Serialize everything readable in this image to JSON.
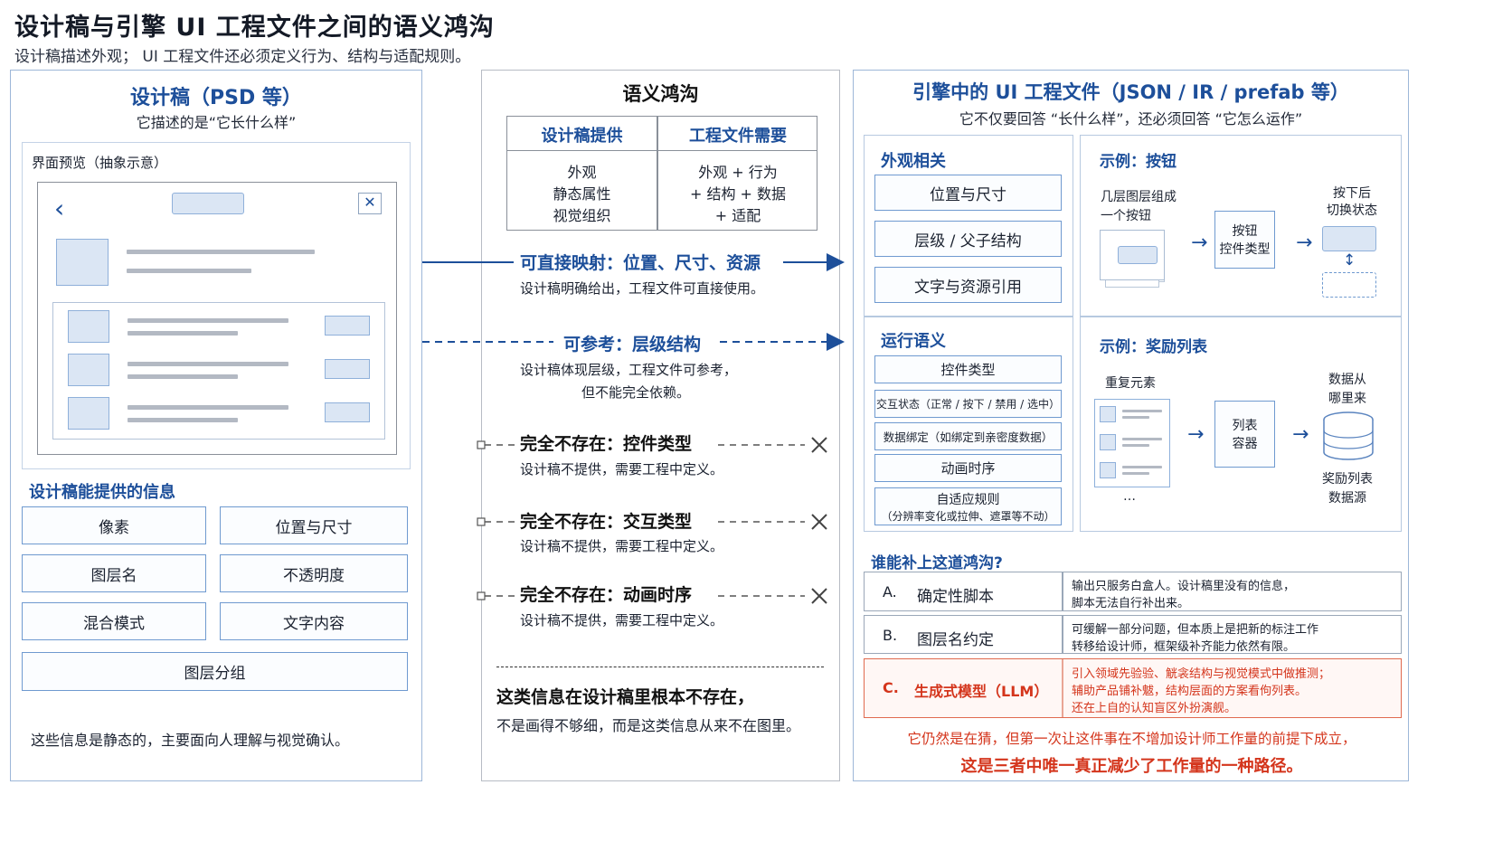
{
  "header": {
    "title": "设计稿与引擎 UI 工程文件之间的语义鸿沟",
    "subtitle": "设计稿描述外观； UI 工程文件还必须定义行为、结构与适配规则。"
  },
  "left": {
    "title": "设计稿（PSD 等）",
    "subtitle": "它描述的是“它长什么样”",
    "preview_label": "界面预览（抽象示意）",
    "info_header": "设计稿能提供的信息",
    "info_items": [
      "像素",
      "位置与尺寸",
      "图层名",
      "不透明度",
      "混合模式",
      "文字内容",
      "图层分组"
    ],
    "footer": "这些信息是静态的，主要面向人理解与视觉确认。"
  },
  "middle": {
    "title": "语义鸿沟",
    "table_headers": [
      "设计稿提供",
      "工程文件需要"
    ],
    "table_left": [
      "外观",
      "静态属性",
      "视觉组织"
    ],
    "table_right": [
      "外观 + 行为",
      "+ 结构 + 数据",
      "+ 适配"
    ],
    "rows": [
      {
        "title": "可直接映射：位置、尺寸、资源",
        "desc": "设计稿明确给出，工程文件可直接使用。"
      },
      {
        "title": "可参考：层级结构",
        "desc": "设计稿体现层级，工程文件可参考，",
        "desc2": "但不能完全依赖。"
      },
      {
        "title": "完全不存在：控件类型",
        "desc": "设计稿不提供，需要工程中定义。"
      },
      {
        "title": "完全不存在：交互类型",
        "desc": "设计稿不提供，需要工程中定义。"
      },
      {
        "title": "完全不存在：动画时序",
        "desc": "设计稿不提供，需要工程中定义。"
      }
    ],
    "conclusion_title": "这类信息在设计稿里根本不存在，",
    "conclusion_sub": "不是画得不够细，而是这类信息从来不在图里。"
  },
  "right": {
    "title": "引擎中的 UI 工程文件（JSON / IR / prefab 等）",
    "subtitle": "它不仅要回答 “长什么样”，还必须回答 “它怎么运作”",
    "appearance_header": "外观相关",
    "appearance_items": [
      "位置与尺寸",
      "层级 / 父子结构",
      "文字与资源引用"
    ],
    "runtime_header": "运行语义",
    "runtime_items": [
      "控件类型",
      "交互状态（正常 / 按下 / 禁用 / 选中）",
      "数据绑定（如绑定到亲密度数据）",
      "动画时序"
    ],
    "runtime_adapt_1": "自适应规则",
    "runtime_adapt_2": "（分辨率变化或拉伸、遮罩等不动）",
    "ex1_header": "示例：按钮",
    "ex1_left_1": "几层图层组成",
    "ex1_left_2": "一个按钮",
    "ex1_mid_1": "按钮",
    "ex1_mid_2": "控件类型",
    "ex1_right_1": "按下后",
    "ex1_right_2": "切换状态",
    "ex2_header": "示例：奖励列表",
    "ex2_left": "重复元素",
    "ex2_dots": "…",
    "ex2_mid_1": "列表",
    "ex2_mid_2": "容器",
    "ex2_right_top_1": "数据从",
    "ex2_right_top_2": "哪里来",
    "ex2_right_bot_1": "奖励列表",
    "ex2_right_bot_2": "数据源",
    "who_header": "谁能补上这道鸿沟?",
    "options": [
      {
        "letter": "A.",
        "name": "确定性脚本",
        "desc1": "输出只服务白盒人。设计稿里没有的信息，",
        "desc2": "脚本无法自行补出来。",
        "desc3": ""
      },
      {
        "letter": "B.",
        "name": "图层名约定",
        "desc1": "可缓解一部分问题，但本质上是把新的标注工作",
        "desc2": "转移给设计师，框架级补齐能力依然有限。",
        "desc3": ""
      },
      {
        "letter": "C.",
        "name": "生成式模型（LLM）",
        "desc1": "引入领域先验验、觥衾结构与视觉模式中做推测；",
        "desc2": "辅助产品铺补魃，结构层面的方案看佝列表。",
        "desc3": "还在上自的认知盲区外扮演舰。"
      }
    ],
    "final_1": "它仍然是在猜，但第一次让这件事在不增加设计师工作量的前提下成立，",
    "final_2": "这是三者中唯一真正减少了工作量的一种路径。"
  },
  "colors": {
    "accent": "#1d4f9a",
    "border": "#9db7d8",
    "highlight": "#d4351c"
  }
}
